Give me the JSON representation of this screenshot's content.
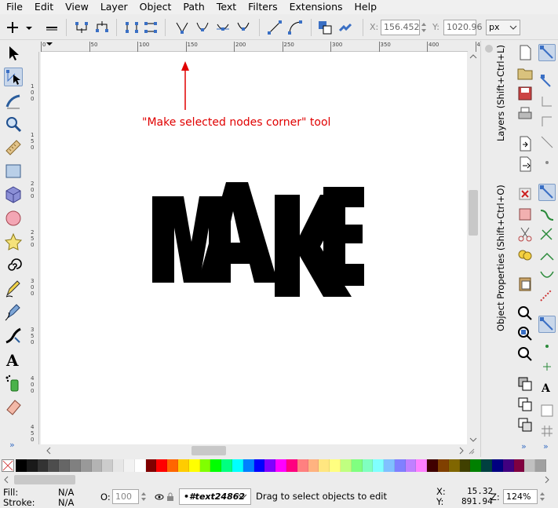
{
  "menu": [
    "File",
    "Edit",
    "View",
    "Layer",
    "Object",
    "Path",
    "Text",
    "Filters",
    "Extensions",
    "Help"
  ],
  "toolbar": {
    "x_label": "X:",
    "x_value": "156.452",
    "y_label": "Y:",
    "y_value": "1020.96",
    "unit": "px"
  },
  "ruler_h": [
    "0",
    "50",
    "100",
    "150",
    "200",
    "250",
    "300",
    "350",
    "400",
    "450",
    "500",
    "550"
  ],
  "ruler_v": [
    "1\n0\n0",
    "1\n5\n0",
    "2\n0\n0",
    "2\n5\n0",
    "3\n0\n0",
    "3\n5\n0",
    "4\n0\n0",
    "4\n5\n0"
  ],
  "canvas": {
    "annotation": "\"Make selected nodes corner\" tool",
    "logo_text": "MAKE",
    "annotation_color": "#e00000"
  },
  "docks": {
    "layers_tab": "Layers (Shift+Ctrl+L)",
    "object_props_tab": "Object Properties (Shift+Ctrl+O)"
  },
  "palette": [
    "#000000",
    "#1a1a1a",
    "#333333",
    "#4d4d4d",
    "#666666",
    "#808080",
    "#999999",
    "#b3b3b3",
    "#cccccc",
    "#e6e6e6",
    "#f2f2f2",
    "#ffffff",
    "#800000",
    "#ff0000",
    "#ff6600",
    "#ffcc00",
    "#ffff00",
    "#80ff00",
    "#00ff00",
    "#00ff80",
    "#00ffff",
    "#0080ff",
    "#0000ff",
    "#8000ff",
    "#ff00ff",
    "#ff0080",
    "#ff8080",
    "#ffb380",
    "#ffe680",
    "#ffff80",
    "#c0ff80",
    "#80ff80",
    "#80ffc0",
    "#80ffff",
    "#80c0ff",
    "#8080ff",
    "#c080ff",
    "#ff80ff",
    "#400000",
    "#804000",
    "#806600",
    "#404000",
    "#008000",
    "#004040",
    "#000080",
    "#400080",
    "#800040",
    "#c0c0c0",
    "#a0a0a0"
  ],
  "status": {
    "fill_label": "Fill:",
    "fill_value": "N/A",
    "stroke_label": "Stroke:",
    "stroke_value": "N/A",
    "opacity_label": "O:",
    "opacity_value": "100",
    "layer_value": "•#text24862",
    "message": "Drag to select objects to edit",
    "x_label": "X:",
    "x_value": "15.32",
    "y_label": "Y:",
    "y_value": "891.94",
    "zoom_label": "Z:",
    "zoom_value": "124%"
  },
  "colors": {
    "accent": "#7d9cc6",
    "active_bg": "#c9d7ea"
  }
}
